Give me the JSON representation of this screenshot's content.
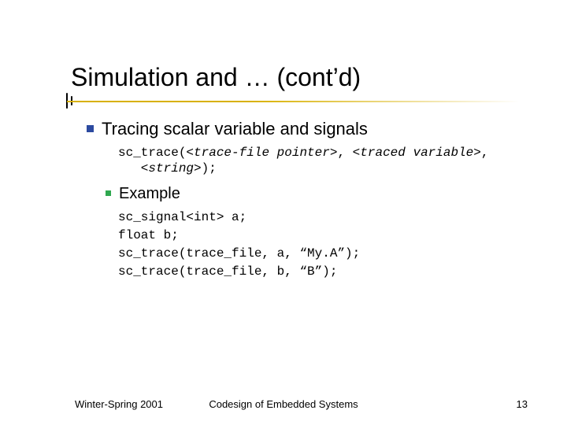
{
  "title": "Simulation and … (cont’d)",
  "bullets": {
    "l1": "Tracing scalar variable and signals",
    "code1_a": "sc_trace(",
    "code1_b": "<trace-file pointer>",
    "code1_c": ", ",
    "code1_d": "<traced variable>",
    "code1_e": ",",
    "code1_f": "   <string>",
    "code1_g": ");",
    "l2": "Example",
    "code2": "sc_signal<int> a;\nfloat b;\nsc_trace(trace_file, a, “My.A”);\nsc_trace(trace_file, b, “B”);"
  },
  "footer": {
    "left": "Winter-Spring 2001",
    "center": "Codesign of Embedded Systems",
    "right": "13"
  }
}
